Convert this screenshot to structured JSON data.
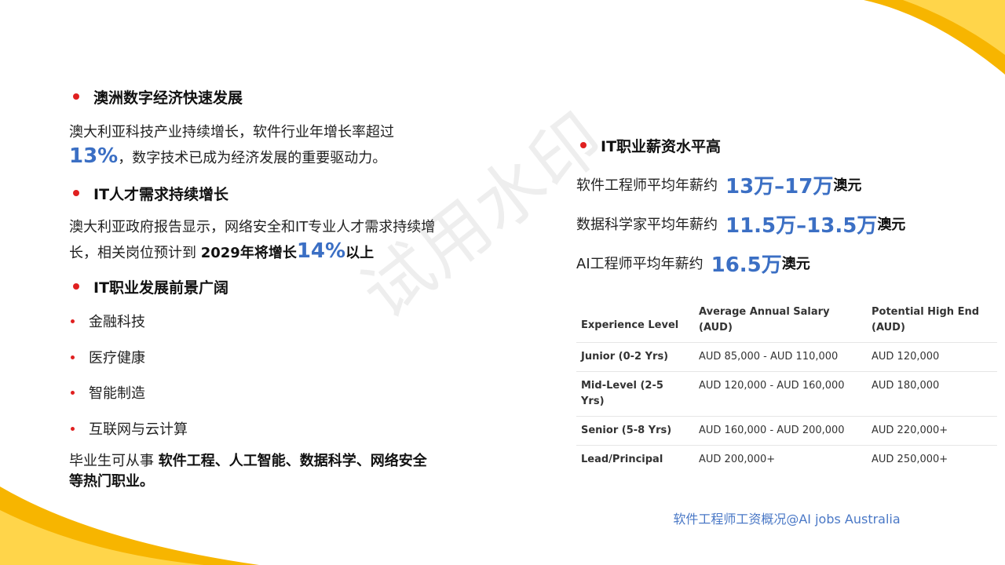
{
  "left": {
    "sec1": {
      "title": "澳洲数字经济快速发展",
      "line1": "澳大利亚科技产业持续增长，软件行业年增长率超过",
      "pct": "13%",
      "line2": "，数字技术已成为经济发展的重要驱动力。"
    },
    "sec2": {
      "title": "IT人才需求持续增长",
      "line1": "澳大利亚政府报告显示，网络安全和IT专业人才需求持续增",
      "line2a": "长，相关岗位预计到 ",
      "bold": "2029年将增长",
      "pct": "14%",
      "tail": "以上"
    },
    "sec3": {
      "title": "IT职业发展前景广阔",
      "items": [
        "金融科技",
        "医疗健康",
        "智能制造",
        "互联网与云计算"
      ]
    },
    "closing": {
      "prefix": "毕业生可从事 ",
      "bold1": "软件工程、人工智能、数据科学、网络安全",
      "bold2": "等热门职业。"
    }
  },
  "right": {
    "title": "IT职业薪资水平高",
    "lines": [
      {
        "label": "软件工程师平均年薪约",
        "value": "13万–17万",
        "unit": "澳元"
      },
      {
        "label": "数据科学家平均年薪约",
        "value": "11.5万–13.5万",
        "unit": "澳元"
      },
      {
        "label": "AI工程师平均年薪约",
        "value": "16.5万",
        "unit": "澳元"
      }
    ]
  },
  "table": {
    "headers": [
      "Experience Level",
      "Average Annual Salary (AUD)",
      "Potential High End (AUD)"
    ],
    "rows": [
      [
        "Junior (0-2 Yrs)",
        "AUD 85,000 - AUD 110,000",
        "AUD 120,000"
      ],
      [
        "Mid-Level (2-5 Yrs)",
        "AUD 120,000 - AUD 160,000",
        "AUD 180,000"
      ],
      [
        "Senior (5-8 Yrs)",
        "AUD 160,000 - AUD 200,000",
        "AUD 220,000+"
      ],
      [
        "Lead/Principal",
        "AUD 200,000+",
        "AUD 250,000+"
      ]
    ],
    "caption": "软件工程师工资概况@AI jobs Australia"
  },
  "watermark": "试用水印",
  "colors": {
    "accent_blue": "#3b6fc4",
    "bullet_red": "#e02020",
    "swoosh_orange": "#f7b500"
  }
}
